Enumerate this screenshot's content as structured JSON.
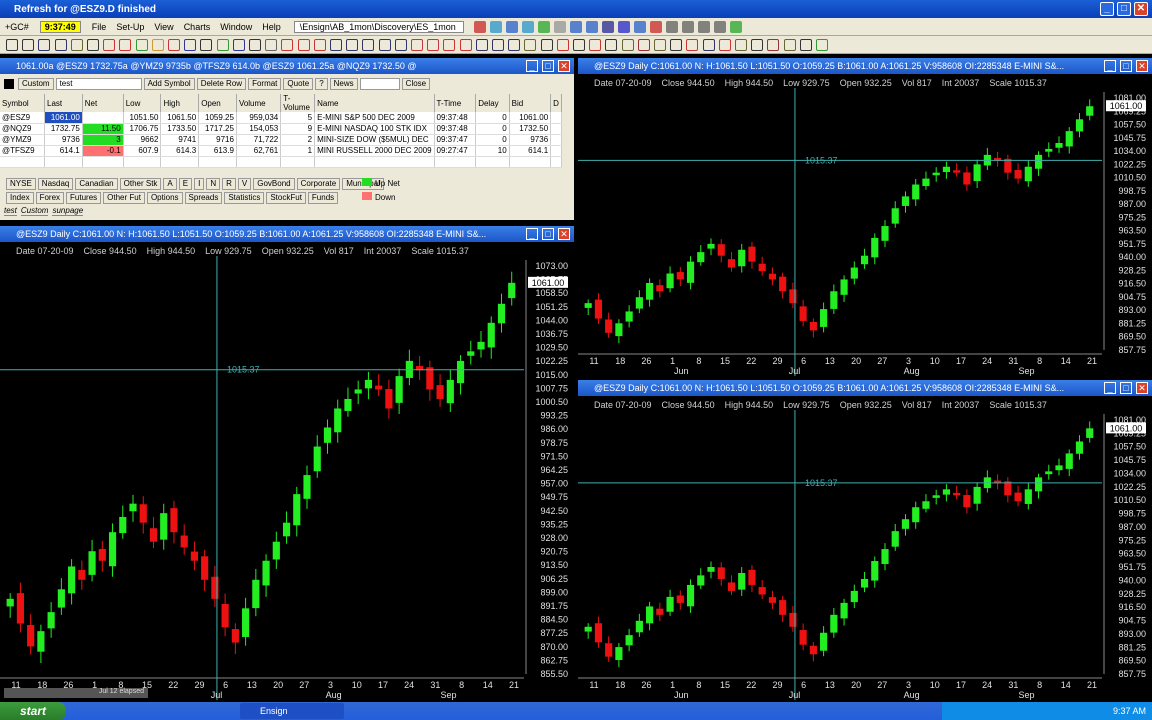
{
  "window": {
    "title": "Refresh for @ESZ9.D finished"
  },
  "menubar": {
    "symbol": "+GC#",
    "clock": "9:37:49",
    "items": [
      "File",
      "Set-Up",
      "View",
      "Charts",
      "Window",
      "Help"
    ],
    "layout_path": "\\Ensign\\AB_1mon\\Discovery\\ES_1mon"
  },
  "ticker": {
    "items": [
      {
        "label": "1061.00a",
        "sym": "@ESZ9"
      },
      {
        "label": "1732.75a",
        "sym": "@YMZ9"
      },
      {
        "label": "9735b",
        "sym": "@TFSZ9"
      },
      {
        "label": "614.0b",
        "sym": "@ESZ9"
      },
      {
        "label": "1061.25a",
        "sym": "@NQZ9"
      },
      {
        "label": "1732.50",
        "sym": "@"
      }
    ],
    "first_prefix": "@NQZ9"
  },
  "quotes": {
    "controls": {
      "custom": "Custom",
      "name": "test",
      "add": "Add Symbol",
      "delete": "Delete Row",
      "format": "Format",
      "quote": "Quote",
      "help": "?",
      "news": "News",
      "close": "Close"
    },
    "columns": [
      "Symbol",
      "Last",
      "Net",
      "Low",
      "High",
      "Open",
      "Volume",
      "T-Volume",
      "Name",
      "T-Time",
      "Delay",
      "Bid",
      "D"
    ],
    "rows": [
      [
        "@ESZ9",
        "1061.00",
        "",
        "1051.50",
        "1061.50",
        "1059.25",
        "959,034",
        "5",
        "E-MINI S&P 500 DEC 2009",
        "09:37:48",
        "0",
        "1061.00",
        ""
      ],
      [
        "@NQZ9",
        "1732.75",
        "11.50",
        "1706.75",
        "1733.50",
        "1717.25",
        "154,053",
        "9",
        "E-MINI NASDAQ 100 STK IDX",
        "09:37:48",
        "0",
        "1732.50",
        ""
      ],
      [
        "@YMZ9",
        "9736",
        "3",
        "9662",
        "9741",
        "9716",
        "71,722",
        "2",
        "MINI-SIZE DOW ($5MUL) DEC",
        "09:37:47",
        "0",
        "9736",
        ""
      ],
      [
        "@TFSZ9",
        "614.1",
        "-0.1",
        "607.9",
        "614.3",
        "613.9",
        "62,761",
        "1",
        "MINI RUSSELL 2000 DEC 2009",
        "09:27:47",
        "10",
        "614.1",
        ""
      ]
    ],
    "net_colors": [
      "",
      "#22dd22",
      "#22dd22",
      "#ff7070"
    ],
    "groups_row1": [
      "NYSE",
      "Nasdaq",
      "Canadian",
      "Other Stk",
      "A",
      "E",
      "I",
      "N",
      "R",
      "V",
      "GovBond",
      "Corporate",
      "Municipal"
    ],
    "groups_row2": [
      "Index",
      "Forex",
      "Futures",
      "Other Fut",
      "Options",
      "Spreads",
      "Statistics",
      "StockFut",
      "Funds"
    ],
    "legend_up": "Up Net",
    "legend_down": "Down",
    "tabs": [
      "test",
      "Custom",
      "sunpage"
    ]
  },
  "chart_title": "@ESZ9 Daily C:1061.00 N: H:1061.50 L:1051.50 O:1059.25 B:1061.00 A:1061.25 V:958608 OI:2285348 E-MINI S&...",
  "chart_info": [
    "Date 07-20-09",
    "Close 944.50",
    "High 944.50",
    "Low 929.75",
    "Open 932.25",
    "Vol 817",
    "Int 20037",
    "Scale 1015.37"
  ],
  "cursor_price": "1015.37",
  "last_price": "1061.00",
  "price_axis": [
    "1073.00",
    "1065.75",
    "1058.50",
    "1051.25",
    "1044.00",
    "1036.75",
    "1029.50",
    "1022.25",
    "1015.00",
    "1007.75",
    "1000.50",
    "993.25",
    "986.00",
    "978.75",
    "971.50",
    "964.25",
    "957.00",
    "949.75",
    "942.50",
    "935.25",
    "928.00",
    "920.75",
    "913.50",
    "906.25",
    "899.00",
    "891.75",
    "884.50",
    "877.25",
    "870.00",
    "862.75",
    "855.50"
  ],
  "price_axis_small": [
    "1081.00",
    "1069.25",
    "1057.50",
    "1045.75",
    "1034.00",
    "1022.25",
    "1010.50",
    "998.75",
    "987.00",
    "975.25",
    "963.50",
    "951.75",
    "940.00",
    "928.25",
    "916.50",
    "904.75",
    "893.00",
    "881.25",
    "869.50",
    "857.75"
  ],
  "date_axis": [
    "11",
    "18",
    "26",
    "1",
    "8",
    "15",
    "22",
    "29",
    "6",
    "13",
    "20",
    "27",
    "3",
    "10",
    "17",
    "24",
    "31",
    "8",
    "14",
    "21"
  ],
  "month_axis": [
    "Jun",
    "Jul",
    "Aug",
    "Sep"
  ],
  "elapsed": "Jul 12 elapsed",
  "taskbar": {
    "start": "start",
    "app": "Ensign",
    "time": "9:37 AM"
  },
  "colors": {
    "up": "#22ee22",
    "down": "#ee1111",
    "crosshair": "#40b0b0"
  },
  "chart_data": {
    "type": "candlestick",
    "title": "",
    "symbol": "@ESZ9",
    "interval": "Daily",
    "ylim": [
      855.5,
      1073
    ],
    "closes": [
      895,
      882,
      870,
      878,
      888,
      900,
      912,
      905,
      920,
      915,
      930,
      938,
      945,
      935,
      925,
      940,
      930,
      922,
      915,
      905,
      895,
      880,
      872,
      890,
      905,
      915,
      925,
      935,
      950,
      960,
      975,
      985,
      995,
      1000,
      1005,
      1010,
      1005,
      995,
      1012,
      1020,
      1015,
      1005,
      1000,
      1010,
      1020,
      1025,
      1030,
      1040,
      1050,
      1061
    ]
  }
}
